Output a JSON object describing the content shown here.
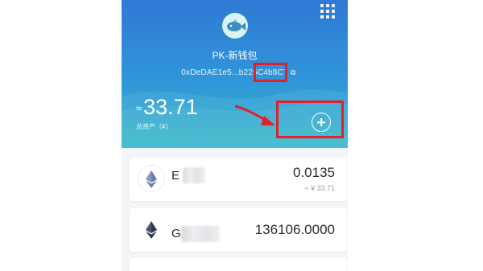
{
  "wallet": {
    "name": "PK-新钱包",
    "address": "0xDeDAE1e5...b225C4b8C7",
    "copy_icon": "copy-icon"
  },
  "balance": {
    "approx_symbol": "≈",
    "amount": "33.71",
    "label": "总资产（¥）"
  },
  "tokens": [
    {
      "name": "E",
      "amount": "0.0135",
      "value": "≈ ¥ 33.71",
      "icon": "ethereum-icon"
    },
    {
      "name": "G",
      "amount": "136106.0000",
      "value": "",
      "icon": "ethereum-icon"
    }
  ],
  "colors": {
    "header_top": "#2f79d4",
    "header_bottom": "#2cb7c7",
    "highlight": "#e0202a"
  }
}
